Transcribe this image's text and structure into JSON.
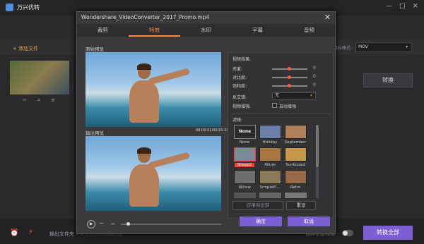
{
  "app": {
    "title": "万兴优转"
  },
  "background": {
    "add_file": "+ 添加文件",
    "output_format_label": "目标格式:",
    "output_format": "MOV",
    "convert": "转换",
    "output_folder_label": "输出文件夹",
    "output_folder": "D:\\万兴优转\\转换完成",
    "merge_all": "合并全部视频",
    "convert_all": "转换全部"
  },
  "dialog": {
    "title": "Wondershare_VideoConverter_2017_Promo.mp4",
    "tabs": [
      "裁剪",
      "特效",
      "水印",
      "字幕",
      "音频"
    ],
    "original_preview": "原始预览",
    "output_preview": "输出预览",
    "timecode": "00:00:01/00:01:21",
    "effects_label": "视频效果:",
    "adjust": [
      {
        "label": "亮度:",
        "value": "0",
        "level": 0.5
      },
      {
        "label": "对比度:",
        "value": "0",
        "level": 0.5
      },
      {
        "label": "饱和度:",
        "value": "0",
        "level": 0.5
      }
    ],
    "deinterlace_label": "反交错:",
    "deinterlace_value": "无",
    "enhance_label": "视频增强:",
    "auto_enhance": "自动增强",
    "filter_label": "滤镜:",
    "filters": [
      {
        "name": "None",
        "color": "#444"
      },
      {
        "name": "Holiday",
        "color": "#6a7ea6"
      },
      {
        "name": "September",
        "color": "#b07f5a"
      },
      {
        "name": "Sheep2",
        "color": "#7a8a96"
      },
      {
        "name": "Allure",
        "color": "#a8763e"
      },
      {
        "name": "Sunkissed",
        "color": "#c8974a"
      },
      {
        "name": "Willow",
        "color": "#6e6e6e"
      },
      {
        "name": "SimpleEl...",
        "color": "#8a7a5a"
      },
      {
        "name": "Retro",
        "color": "#9a6a48"
      }
    ],
    "none_thumb_text": "None",
    "apply_all": "应用到全部",
    "reset": "重设",
    "ok": "确定",
    "cancel": "取消"
  }
}
